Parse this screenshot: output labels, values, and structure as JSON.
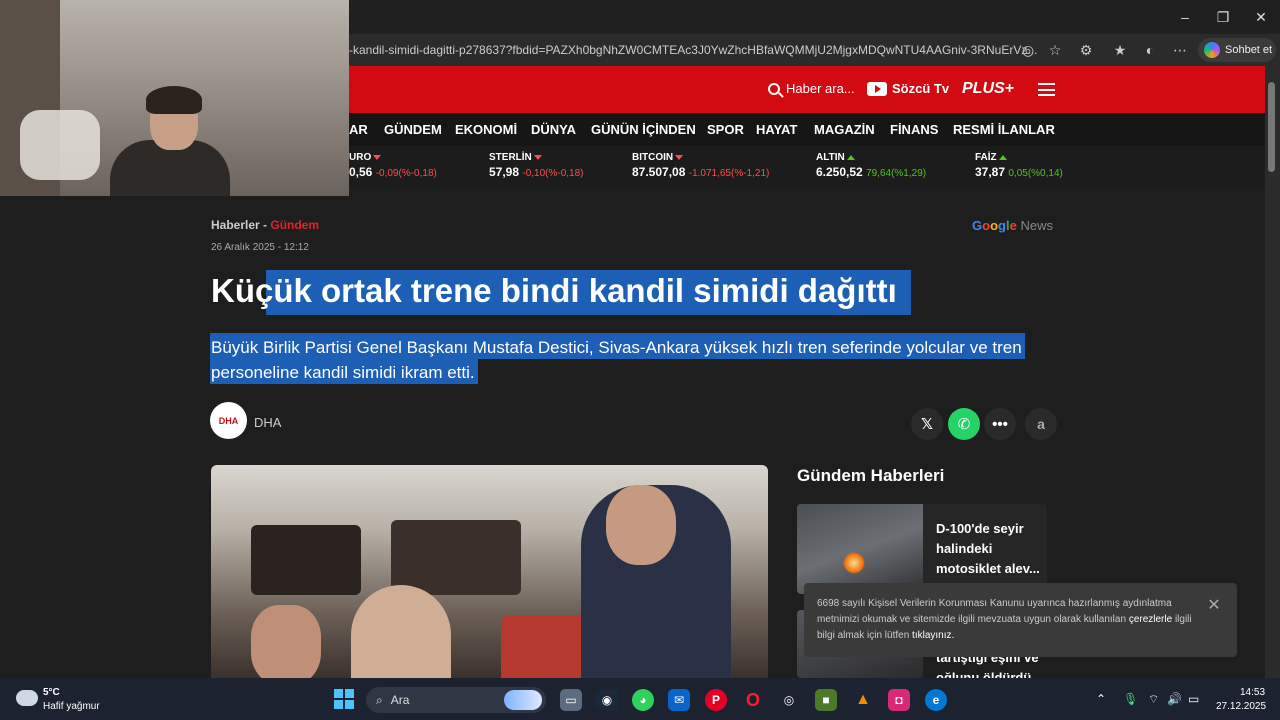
{
  "browser": {
    "url": "-kandil-simidi-dagitti-p278637?fbdid=PAZXh0bgNhZW0CMTEAc3J0YwZhcHBfaWQMMjU2MjgxMDQwNTU4AAGniv-3RNuErVz...",
    "chat_label": "Sohbet et",
    "minimize": "–",
    "maximize": "❐",
    "close": "✕"
  },
  "header": {
    "search_label": "Haber ara...",
    "tv_label": "Sözcü Tv",
    "plus_label": "PLUS+"
  },
  "nav": {
    "items": [
      "AR",
      "GÜNDEM",
      "EKONOMİ",
      "DÜNYA",
      "GÜNÜN İÇİNDEN",
      "SPOR",
      "HAYAT",
      "MAGAZİN",
      "FİNANS",
      "RESMİ İLANLAR"
    ]
  },
  "ticker": [
    {
      "name": "URO",
      "value": "0,56",
      "change": "-0,09(%-0,18)",
      "dir": "down"
    },
    {
      "name": "STERLİN",
      "value": "57,98",
      "change": "-0,10(%-0,18)",
      "dir": "down"
    },
    {
      "name": "BITCOIN",
      "value": "87.507,08",
      "change": "-1.071,65(%-1,21)",
      "dir": "down"
    },
    {
      "name": "ALTIN",
      "value": "6.250,52",
      "change": "79,64(%1,29)",
      "dir": "up"
    },
    {
      "name": "FAİZ",
      "value": "37,87",
      "change": "0,05(%0,14)",
      "dir": "up"
    }
  ],
  "article": {
    "breadcrumb_home": "Haberler",
    "breadcrumb_sep": " - ",
    "breadcrumb_cat": "Gündem",
    "date": "26 Aralık 2025 - 12:12",
    "google_news": "News",
    "title": "Küçük ortak trene bindi kandil simidi dağıttı",
    "lead": "Büyük Birlik Partisi Genel Başkanı Mustafa Destici, Sivas-Ankara yüksek hızlı tren seferinde yolcular ve tren personeline kandil simidi ikram etti.",
    "source_logo": "DHA",
    "source_name": "DHA"
  },
  "sidebar": {
    "title": "Gündem Haberleri",
    "card1_text": "D-100'de seyir halindeki motosiklet alev...",
    "card2_text": "tartıştığı eşini ve oğlunu öldürdü"
  },
  "cookie": {
    "text": "6698 sayılı Kişisel Verilerin Korunması Kanunu uyarınca hazırlanmış aydınlatma metnimizi okumak ve sitemizde ilgili mevzuata uygun olarak kullanılan ",
    "link1": "çerezlerle",
    "text2": " ilgili bilgi almak için lütfen ",
    "link2": "tıklayınız."
  },
  "taskbar": {
    "temp": "5°C",
    "weather": "Hafif yağmur",
    "search": "Ara",
    "time": "14:53",
    "date": "27.12.2025"
  },
  "colors": {
    "brand_red": "#d20a11",
    "selection": "#1d5fb4",
    "down": "#ff4d4f",
    "up": "#52c41a"
  }
}
